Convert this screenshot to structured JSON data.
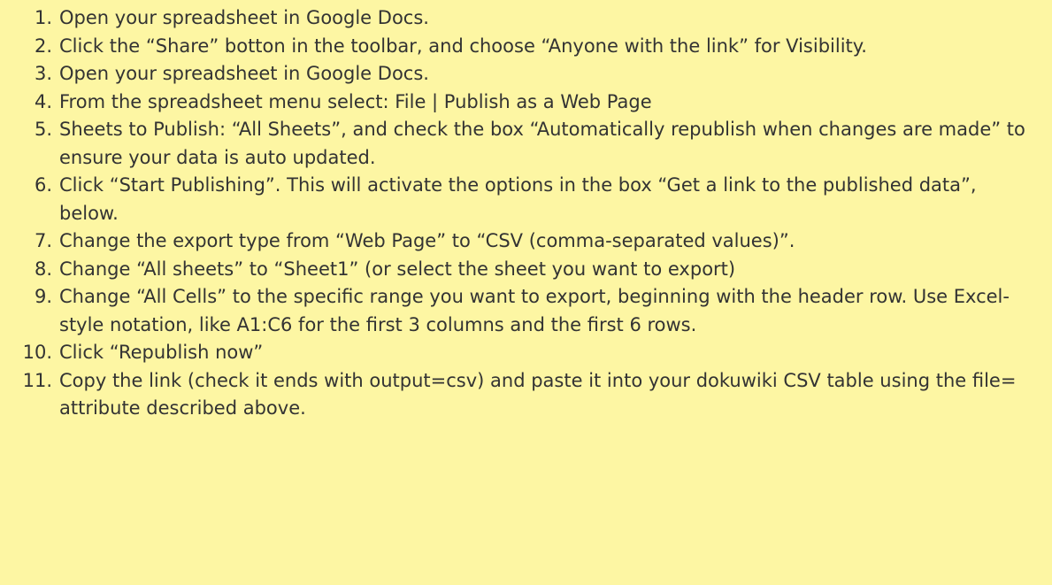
{
  "steps": [
    {
      "num": "1.",
      "text": "Open your spreadsheet in Google Docs."
    },
    {
      "num": "2.",
      "text": "Click the “Share” botton in the toolbar, and choose “Anyone with the link” for Visibility."
    },
    {
      "num": "3.",
      "text": "Open your spreadsheet in Google Docs."
    },
    {
      "num": "4.",
      "text": "From the spreadsheet menu select: File | Publish as a Web Page"
    },
    {
      "num": "5.",
      "text": "Sheets to Publish: “All Sheets”, and check the box “Automatically republish when changes are made” to ensure your data is auto updated."
    },
    {
      "num": "6.",
      "text": "Click “Start Publishing”. This will activate the options in the box “Get a link to the published data”, below."
    },
    {
      "num": "7.",
      "text": "Change the export type from “Web Page” to “CSV (comma-separated values)”."
    },
    {
      "num": "8.",
      "text": "Change “All sheets” to “Sheet1” (or select the sheet you want to export)"
    },
    {
      "num": "9.",
      "text": "Change “All Cells” to the specific range you want to export, beginning with the header row. Use Excel-style notation, like A1:C6 for the first 3 columns and the first 6 rows."
    },
    {
      "num": "10.",
      "text": "Click “Republish now”"
    },
    {
      "num": "11.",
      "text": "Copy the link (check it ends with output=csv) and paste it into your dokuwiki CSV table using the file= attribute described above."
    }
  ]
}
